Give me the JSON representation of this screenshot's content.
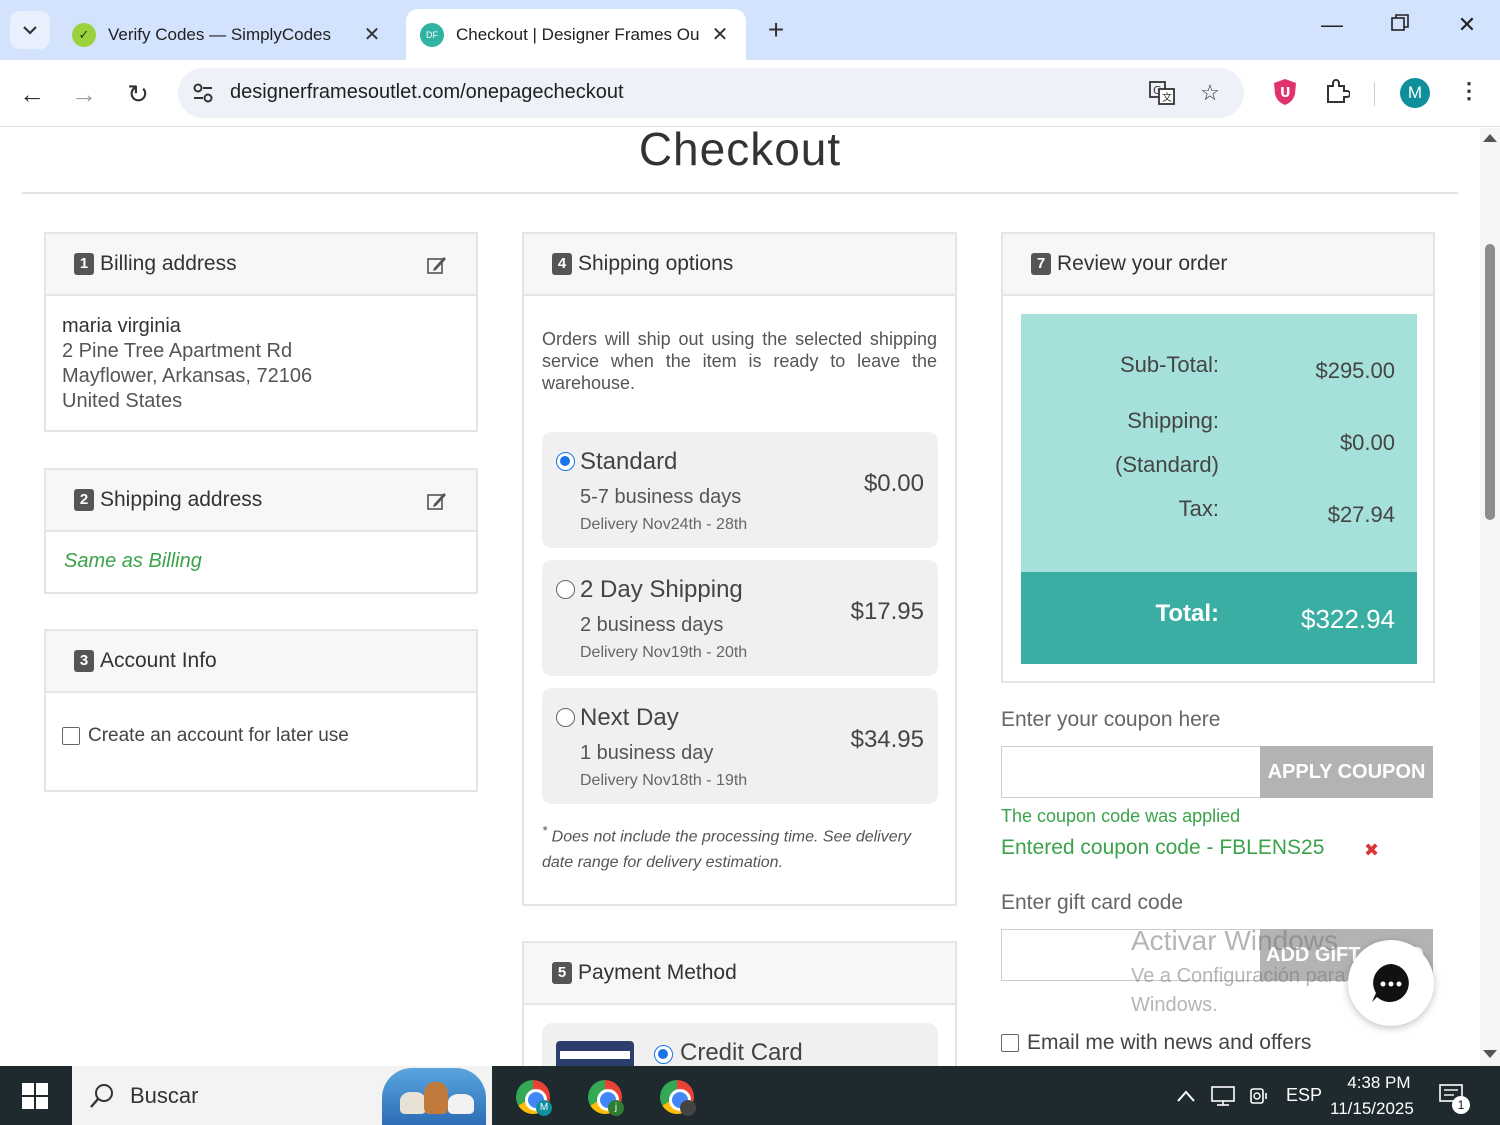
{
  "browser": {
    "tabs": [
      {
        "title": "Verify Codes — SimplyCodes",
        "active": false
      },
      {
        "title": "Checkout | Designer Frames Ou",
        "active": true
      }
    ],
    "url": "designerframesoutlet.com/onepagecheckout",
    "profile_initial": "M"
  },
  "page": {
    "title": "Checkout"
  },
  "billing": {
    "step": "1",
    "heading": "Billing address",
    "name": "maria virginia",
    "line1": "2 Pine Tree Apartment Rd",
    "line2": "Mayflower, Arkansas, 72106",
    "country": "United States"
  },
  "shipping_address": {
    "step": "2",
    "heading": "Shipping address",
    "value": "Same as Billing"
  },
  "account": {
    "step": "3",
    "heading": "Account Info",
    "checkbox_label": "Create an account for later use"
  },
  "shipping_options": {
    "step": "4",
    "heading": "Shipping options",
    "note": "Orders will ship out using the selected shipping service when the item is ready to leave the warehouse.",
    "options": [
      {
        "name": "Standard",
        "days": "5-7 business days",
        "delivery": "Delivery Nov24th - 28th",
        "price": "$0.00",
        "selected": true
      },
      {
        "name": "2 Day Shipping",
        "days": "2 business days",
        "delivery": "Delivery Nov19th - 20th",
        "price": "$17.95",
        "selected": false
      },
      {
        "name": "Next Day",
        "days": "1 business day",
        "delivery": "Delivery Nov18th - 19th",
        "price": "$34.95",
        "selected": false
      }
    ],
    "footnote_star": "*",
    "footnote": "Does not include the processing time. See delivery date range for delivery estimation."
  },
  "payment": {
    "step": "5",
    "heading": "Payment Method",
    "option": "Credit Card"
  },
  "review": {
    "step": "7",
    "heading": "Review your order",
    "subtotal_label": "Sub-Total:",
    "subtotal": "$295.00",
    "shipping_label": "Shipping:",
    "shipping_method": "(Standard)",
    "shipping": "$0.00",
    "tax_label": "Tax:",
    "tax": "$27.94",
    "total_label": "Total:",
    "total": "$322.94"
  },
  "coupon": {
    "label": "Enter your coupon here",
    "button": "APPLY COUPON",
    "applied_msg": "The coupon code was applied",
    "entered": "Entered coupon code - FBLENS25",
    "remove": "✖"
  },
  "giftcard": {
    "label": "Enter gift card code",
    "button": "ADD GIFT CARD"
  },
  "newsletter": {
    "label": "Email me with news and offers"
  },
  "windows_watermark": {
    "line1": "Activar Windows",
    "line2": "Ve a Configuración para activar",
    "line3": "Windows."
  },
  "taskbar": {
    "search_placeholder": "Buscar",
    "language": "ESP",
    "time": "4:38 PM",
    "date": "11/15/2025",
    "notifications": "1",
    "app_badges": [
      "M",
      "j",
      ""
    ]
  },
  "colors": {
    "summary_light": "#a6e0da",
    "summary_dark": "#3aaea3",
    "success_green": "#3aa34a",
    "chrome_tabstrip": "#d3e3fd"
  }
}
